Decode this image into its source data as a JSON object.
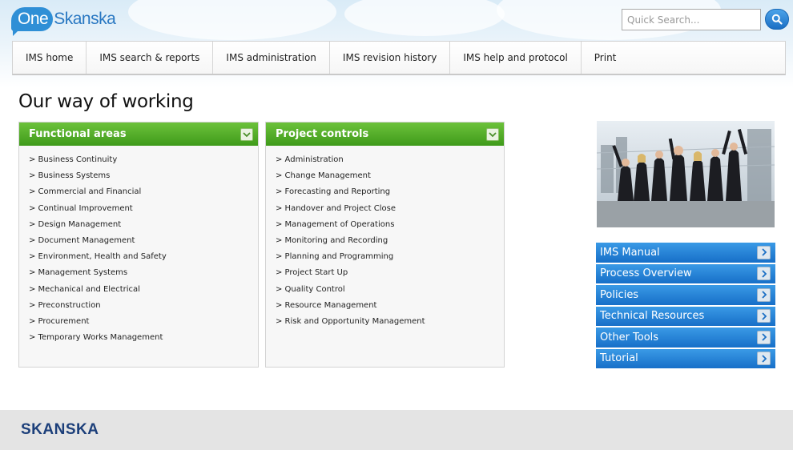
{
  "logo": {
    "one": "One",
    "rest": "Skanska"
  },
  "search": {
    "placeholder": "Quick Search..."
  },
  "nav": {
    "items": [
      {
        "label": "IMS home"
      },
      {
        "label": "IMS search & reports"
      },
      {
        "label": "IMS administration"
      },
      {
        "label": "IMS revision history"
      },
      {
        "label": "IMS help and protocol"
      },
      {
        "label": "Print"
      }
    ]
  },
  "page": {
    "title": "Our way of working"
  },
  "panels": [
    {
      "title": "Functional areas",
      "items": [
        "> Business Continuity",
        "> Business Systems",
        "> Commercial and Financial",
        "> Continual Improvement",
        "> Design Management",
        "> Document Management",
        "> Environment, Health and Safety",
        "> Management Systems",
        "> Mechanical and Electrical",
        "> Preconstruction",
        "> Procurement",
        "> Temporary Works Management"
      ]
    },
    {
      "title": "Project controls",
      "items": [
        "> Administration",
        "> Change Management",
        "> Forecasting and Reporting",
        "> Handover and Project Close",
        "> Management of Operations",
        "> Monitoring and Recording",
        "> Planning and Programming",
        "> Project Start Up",
        "> Quality Control",
        "> Resource Management",
        "> Risk and Opportunity Management"
      ]
    }
  ],
  "side_menu": {
    "items": [
      {
        "label": "IMS Manual"
      },
      {
        "label": "Process Overview"
      },
      {
        "label": "Policies"
      },
      {
        "label": "Technical Resources"
      },
      {
        "label": "Other Tools"
      },
      {
        "label": "Tutorial"
      }
    ]
  },
  "footer": {
    "logo": "SKANSKA"
  },
  "colors": {
    "panel_header": "#4fa824",
    "side_menu": "#2684d6",
    "brand_blue": "#2f8fd6",
    "footer_logo": "#1c3f7a"
  }
}
